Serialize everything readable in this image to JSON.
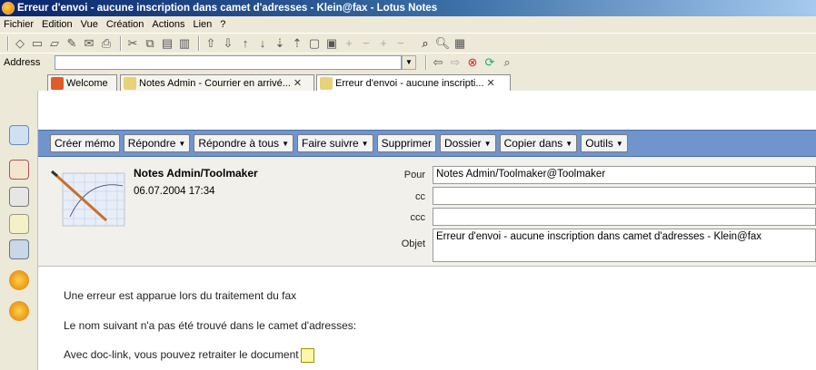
{
  "window": {
    "title": "Erreur d'envoi - aucune inscription dans camet d'adresses - Klein@fax - Lotus Notes"
  },
  "menu": [
    "Fichier",
    "Edition",
    "Vue",
    "Création",
    "Actions",
    "Lien",
    "?"
  ],
  "address": {
    "label": "Address",
    "value": ""
  },
  "tabs": [
    {
      "label": "Welcome",
      "closable": false
    },
    {
      "label": "Notes Admin - Courrier en arrivé...",
      "closable": true
    },
    {
      "label": "Erreur d'envoi - aucune inscripti...",
      "closable": true
    }
  ],
  "actions": {
    "creer_memo": "Créer mémo",
    "repondre": "Répondre",
    "repondre_tous": "Répondre à tous",
    "faire_suivre": "Faire suivre",
    "supprimer": "Supprimer",
    "dossier": "Dossier",
    "copier_dans": "Copier dans",
    "outils": "Outils"
  },
  "memo": {
    "sender": "Notes Admin/Toolmaker",
    "date": "06.07.2004 17:34",
    "labels": {
      "pour": "Pour",
      "cc": "cc",
      "ccc": "ccc",
      "objet": "Objet"
    },
    "pour": "Notes Admin/Toolmaker@Toolmaker",
    "cc": "",
    "ccc": "",
    "objet": "Erreur d'envoi - aucune inscription dans camet d'adresses - Klein@fax"
  },
  "body": {
    "line1": "Une erreur est apparue lors du traitement du fax",
    "line2": "Le nom suivant n'a pas été trouvé dans le camet d'adresses:",
    "line3": "Avec doc-link, vous pouvez retraiter le document"
  },
  "colors": {
    "titlebar": "#0a246a",
    "actionbar": "#6f95cc",
    "header_bg": "#f2f0eb"
  }
}
